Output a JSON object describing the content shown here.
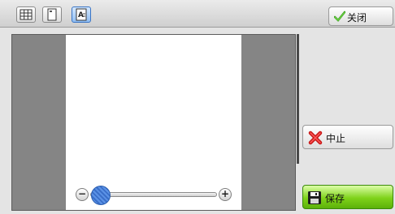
{
  "toolbar": {
    "view_buttons": [
      {
        "icon": "grid-view-icon",
        "active": false
      },
      {
        "icon": "page-view-icon",
        "active": false
      },
      {
        "icon": "text-page-view-icon",
        "active": true
      }
    ],
    "close_label": "关闭",
    "close_icon": "checkmark-icon"
  },
  "actions": {
    "stop_label": "中止",
    "stop_icon": "red-x-icon",
    "save_label": "保存",
    "save_icon": "floppy-disk-icon"
  },
  "zoom": {
    "level": 0.0
  },
  "colors": {
    "accent": "#3a74c4",
    "save_green": "#7fd21a",
    "stop_red": "#e02020"
  }
}
